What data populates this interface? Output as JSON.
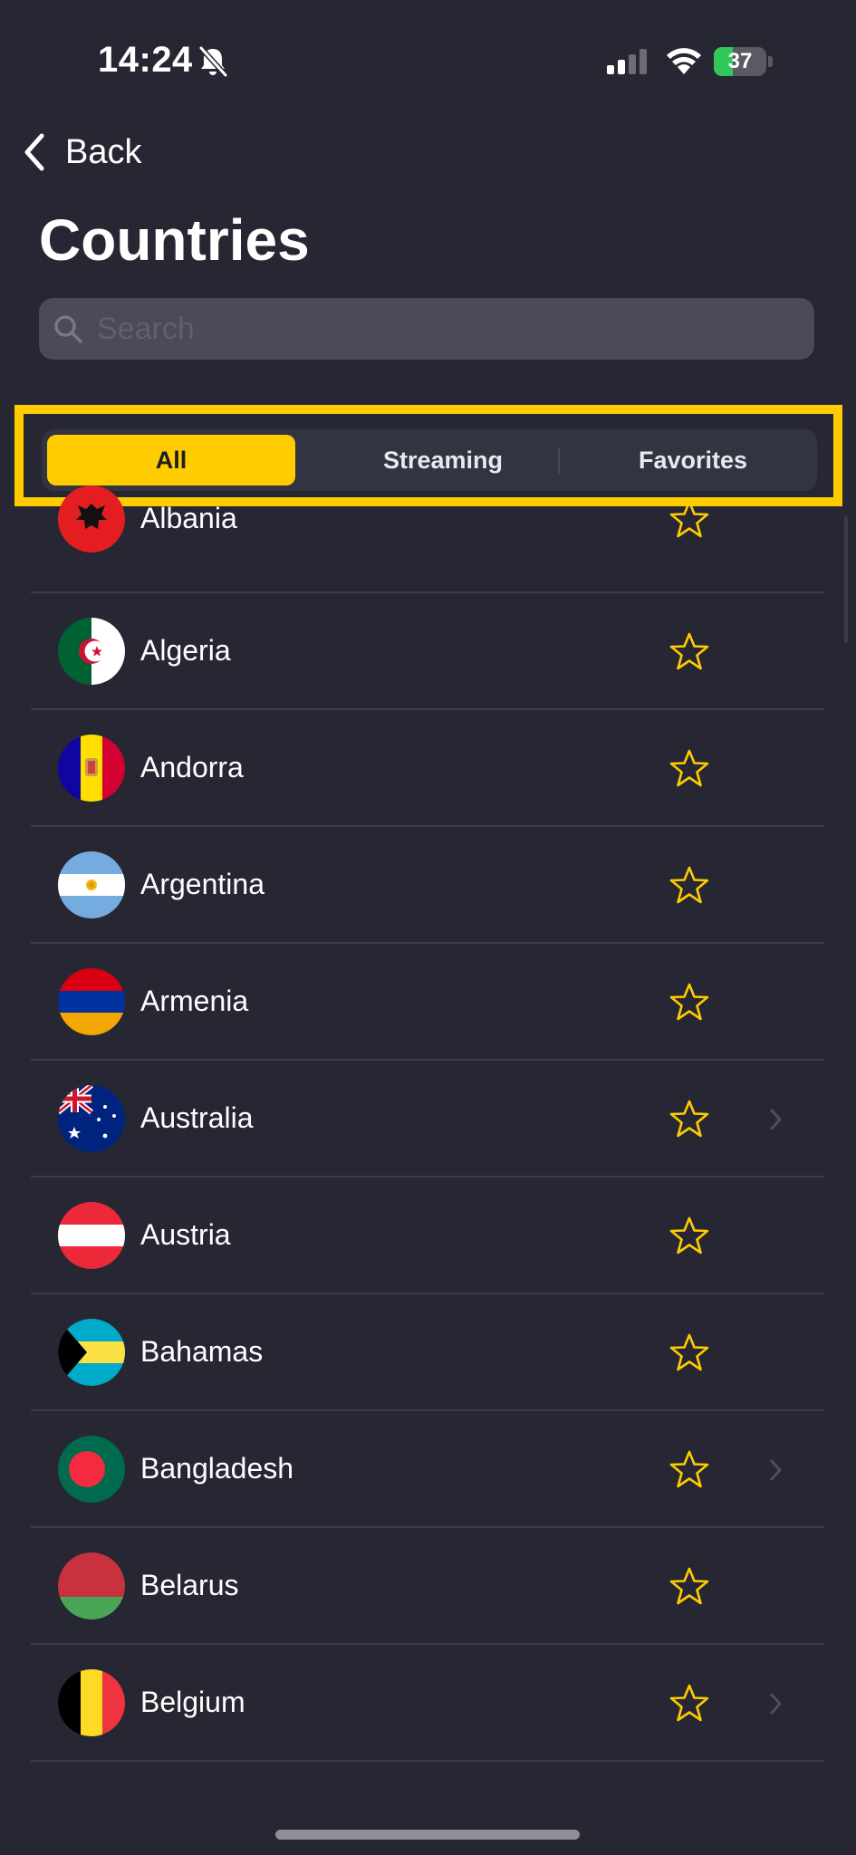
{
  "status_bar": {
    "time": "14:24",
    "battery_percent": "37",
    "battery_level": 0.37,
    "icons": [
      "bell-slash-icon",
      "cellular-signal-icon",
      "wifi-icon",
      "battery-charging-icon"
    ]
  },
  "nav": {
    "back_label": "Back",
    "back_icon": "chevron-left-icon"
  },
  "title": "Countries",
  "search": {
    "placeholder": "Search",
    "value": "",
    "icon": "search-icon"
  },
  "tabs": [
    {
      "label": "All",
      "active": true
    },
    {
      "label": "Streaming",
      "active": false
    },
    {
      "label": "Favorites",
      "active": false
    }
  ],
  "countries": [
    {
      "name": "Albania",
      "has_chevron": false,
      "favorite": false
    },
    {
      "name": "Algeria",
      "has_chevron": false,
      "favorite": false
    },
    {
      "name": "Andorra",
      "has_chevron": false,
      "favorite": false
    },
    {
      "name": "Argentina",
      "has_chevron": false,
      "favorite": false
    },
    {
      "name": "Armenia",
      "has_chevron": false,
      "favorite": false
    },
    {
      "name": "Australia",
      "has_chevron": true,
      "favorite": false
    },
    {
      "name": "Austria",
      "has_chevron": false,
      "favorite": false
    },
    {
      "name": "Bahamas",
      "has_chevron": false,
      "favorite": false
    },
    {
      "name": "Bangladesh",
      "has_chevron": true,
      "favorite": false
    },
    {
      "name": "Belarus",
      "has_chevron": false,
      "favorite": false
    },
    {
      "name": "Belgium",
      "has_chevron": true,
      "favorite": false
    }
  ],
  "colors": {
    "background": "#262733",
    "accent": "#ffcc00",
    "star": "#ffcc00",
    "battery": "#33c759"
  }
}
